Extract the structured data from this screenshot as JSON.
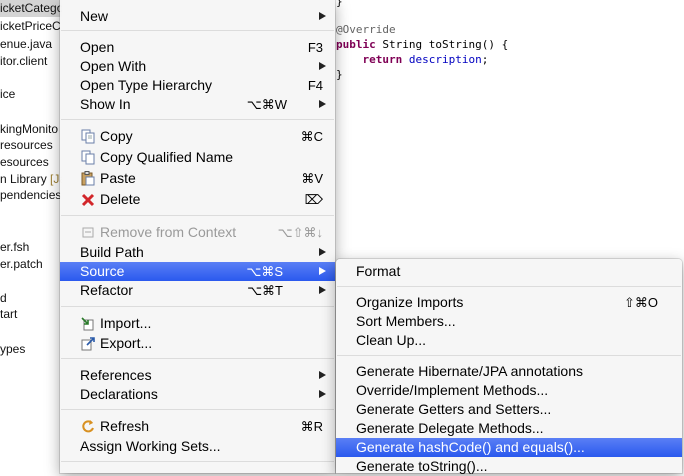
{
  "explorer": {
    "items": [
      {
        "text": "icketCatego",
        "deco": ""
      },
      {
        "text": "icketPriceC",
        "deco": ""
      },
      {
        "text": "enue.java",
        "deco": ""
      },
      {
        "text": "itor.client",
        "deco": ""
      },
      {
        "text": "ice",
        "deco": ""
      },
      {
        "text": "kingMonito",
        "deco": ""
      },
      {
        "text": "resources",
        "deco": ""
      },
      {
        "text": "esources",
        "deco": ""
      },
      {
        "text": "n Library ",
        "deco": "[Ja"
      },
      {
        "text": "pendencies",
        "deco": ""
      },
      {
        "text": "er.fsh",
        "deco": ""
      },
      {
        "text": "er.patch",
        "deco": ""
      },
      {
        "text": "d",
        "deco": ""
      },
      {
        "text": "tart",
        "deco": ""
      },
      {
        "text": "ypes",
        "deco": ""
      }
    ]
  },
  "editor": {
    "closing_brace_top": "}",
    "annotation": "@Override",
    "kw_public": "public",
    "signature": " String toString() {",
    "kw_return": "return",
    "field": "description",
    "semicolon": ";",
    "closing_brace": "}"
  },
  "context_menu": {
    "new": "New",
    "open": "Open",
    "open_shortcut": "F3",
    "open_with": "Open With",
    "open_type_hierarchy": "Open Type Hierarchy",
    "open_type_hierarchy_shortcut": "F4",
    "show_in": "Show In",
    "show_in_shortcut": "⌥⌘W",
    "copy": "Copy",
    "copy_shortcut": "⌘C",
    "copy_qualified_name": "Copy Qualified Name",
    "paste": "Paste",
    "paste_shortcut": "⌘V",
    "delete": "Delete",
    "delete_shortcut": "⌦",
    "remove_from_context": "Remove from Context",
    "remove_from_context_shortcut": "⌥⇧⌘↓",
    "build_path": "Build Path",
    "source": "Source",
    "source_shortcut": "⌥⌘S",
    "refactor": "Refactor",
    "refactor_shortcut": "⌥⌘T",
    "import": "Import...",
    "export": "Export...",
    "references": "References",
    "declarations": "Declarations",
    "refresh": "Refresh",
    "refresh_shortcut": "⌘R",
    "assign_working_sets": "Assign Working Sets..."
  },
  "source_menu": {
    "format": "Format",
    "organize_imports": "Organize Imports",
    "organize_imports_shortcut": "⇧⌘O",
    "sort_members": "Sort Members...",
    "clean_up": "Clean Up...",
    "gen_hibernate": "Generate Hibernate/JPA annotations",
    "override_implement": "Override/Implement Methods...",
    "gen_getters_setters": "Generate Getters and Setters...",
    "gen_delegate": "Generate Delegate Methods...",
    "gen_hashcode_equals": "Generate hashCode() and equals()...",
    "gen_tostring": "Generate toString()..."
  },
  "colors": {
    "highlight": "#2a59ee",
    "disabled_text": "#9a9a9a",
    "keyword": "#7f0055",
    "field": "#0000c0",
    "annotation": "#646464"
  }
}
